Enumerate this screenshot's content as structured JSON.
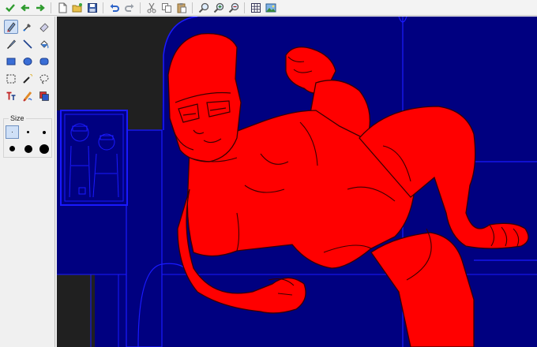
{
  "toolbar": {
    "buttons": [
      {
        "name": "confirm-check-icon",
        "color": "#2e9b2e"
      },
      {
        "name": "arrow-left-icon",
        "color": "#2e9b2e"
      },
      {
        "name": "arrow-right-icon",
        "color": "#2e9b2e"
      },
      {
        "name": "new-file-icon"
      },
      {
        "name": "open-folder-icon"
      },
      {
        "name": "save-disk-icon"
      },
      {
        "name": "undo-icon"
      },
      {
        "name": "redo-icon"
      },
      {
        "name": "cut-scissors-icon"
      },
      {
        "name": "copy-icon"
      },
      {
        "name": "paste-icon"
      },
      {
        "name": "zoom-icon"
      },
      {
        "name": "zoom-in-icon"
      },
      {
        "name": "zoom-out-icon"
      },
      {
        "name": "grid-icon"
      },
      {
        "name": "image-icon"
      }
    ]
  },
  "tools": [
    "pencil-icon",
    "color-picker-icon",
    "eraser-icon",
    "brush-icon",
    "line-icon",
    "fill-bucket-icon",
    "rectangle-icon",
    "ellipse-icon",
    "rounded-rectangle-icon",
    "rect-select-icon",
    "magic-wand-icon",
    "lasso-select-icon",
    "text-icon",
    "smudge-icon",
    "color-swap-icon"
  ],
  "active_tool": "pencil-icon",
  "size": {
    "label": "Size",
    "options": [
      "size-1",
      "size-2",
      "size-3",
      "size-4",
      "size-5",
      "size-6"
    ],
    "active": "size-1"
  },
  "canvas": {
    "colors": {
      "background": "#000080",
      "figure": "#ff0000",
      "outline": "#1a1aff",
      "dark": "#222222"
    }
  }
}
